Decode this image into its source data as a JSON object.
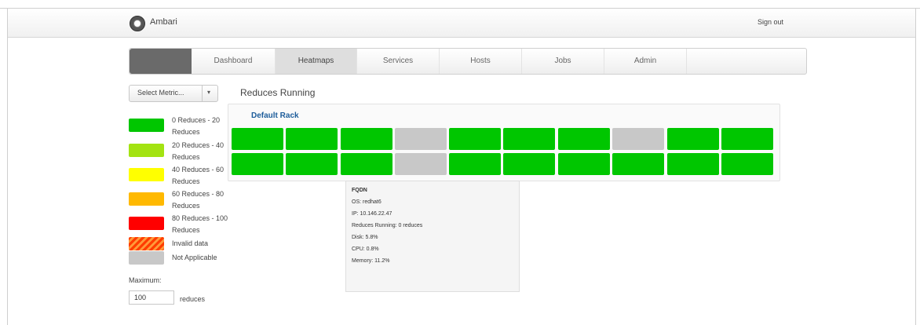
{
  "app": {
    "name": "Ambari",
    "sign_out": "Sign out"
  },
  "nav": {
    "tabs": [
      {
        "label": "Dashboard",
        "active": false
      },
      {
        "label": "Heatmaps",
        "active": true
      },
      {
        "label": "Services",
        "active": false
      },
      {
        "label": "Hosts",
        "active": false
      },
      {
        "label": "Jobs",
        "active": false
      },
      {
        "label": "Admin",
        "active": false
      }
    ]
  },
  "metric_select": {
    "label": "Select Metric...",
    "caret": "▾"
  },
  "legend": [
    {
      "label": "0 Reduces - 20 Reduces",
      "color": "#00c600"
    },
    {
      "label": "20 Reduces - 40 Reduces",
      "color": "#a3e312"
    },
    {
      "label": "40 Reduces - 60 Reduces",
      "color": "#ffff00"
    },
    {
      "label": "60 Reduces - 80 Reduces",
      "color": "#ffb900"
    },
    {
      "label": "80 Reduces - 100 Reduces",
      "color": "#ff0000"
    },
    {
      "label": "Invalid data",
      "color": "#ff5a1e"
    },
    {
      "label": "Not Applicable",
      "color": "#c8c8c8"
    }
  ],
  "maximum": {
    "label": "Maximum:",
    "value": "100",
    "unit": "reduces"
  },
  "heatmap": {
    "title": "Reduces Running",
    "rack": "Default Rack",
    "rows": [
      [
        "green",
        "green",
        "green",
        "gray",
        "green",
        "green",
        "green",
        "gray",
        "green",
        "green"
      ],
      [
        "green",
        "green",
        "green",
        "gray",
        "green",
        "green",
        "green",
        "green",
        "green",
        "green"
      ]
    ]
  },
  "tooltip": {
    "lines": [
      "FQDN",
      "OS: redhat6",
      "IP: 10.146.22.47",
      "Reduces Running: 0 reduces",
      "Disk: 5.8%",
      "CPU: 0.8%",
      "Memory: 11.2%"
    ]
  },
  "colors": {
    "green": "#00c600",
    "gray": "#c8c8c8",
    "link": "#1c5c9a"
  }
}
